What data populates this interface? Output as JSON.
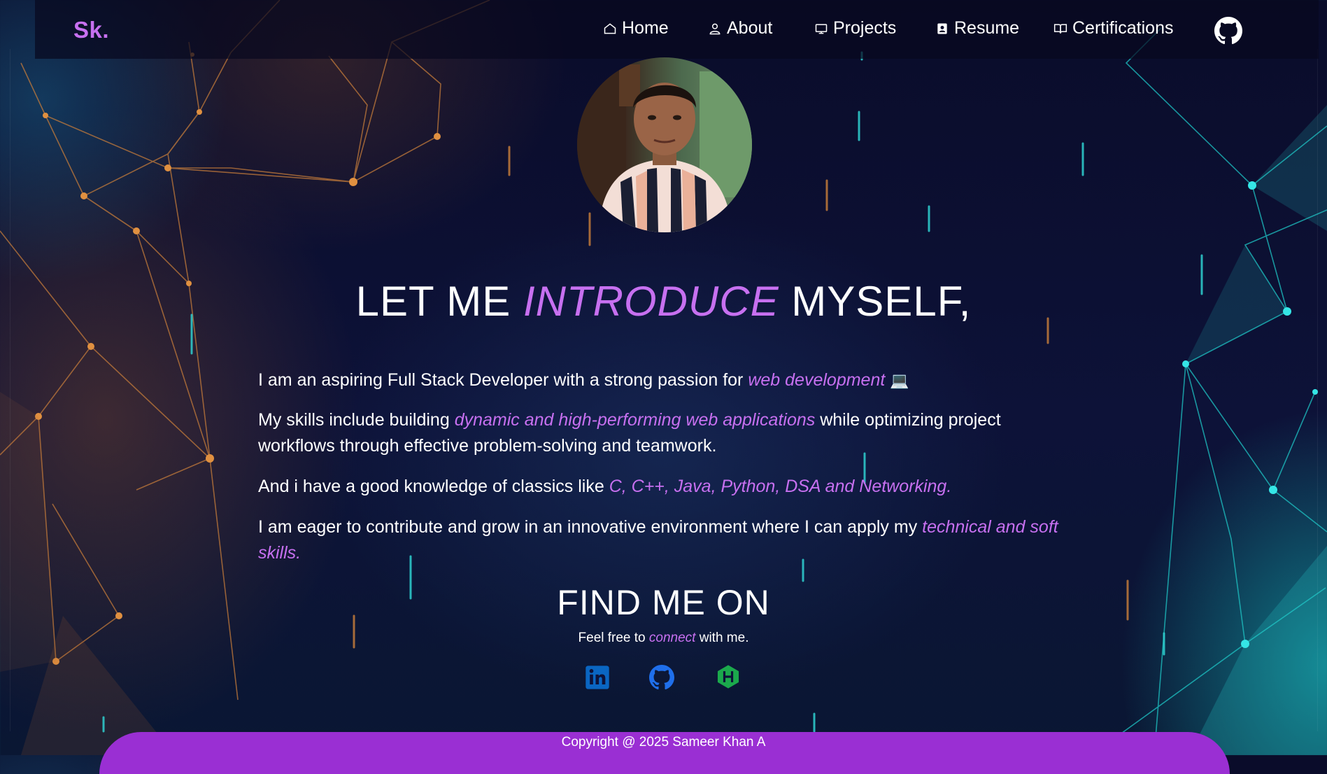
{
  "nav": {
    "logo": "Sk.",
    "items": [
      {
        "label": "Home",
        "icon": "home-icon"
      },
      {
        "label": "About",
        "icon": "user-icon"
      },
      {
        "label": "Projects",
        "icon": "monitor-icon"
      },
      {
        "label": "Resume",
        "icon": "resume-icon"
      },
      {
        "label": "Certifications",
        "icon": "book-icon"
      }
    ],
    "github_icon": "github-icon"
  },
  "intro": {
    "title_pre": "LET ME ",
    "title_accent": "INTRODUCE",
    "title_post": " MYSELF,",
    "p1_text": "I am an aspiring Full Stack Developer with a strong passion for ",
    "p1_highlight": "web development",
    "p1_emoji": "💻",
    "p2_text": "My skills include building ",
    "p2_highlight": "dynamic and high-performing web applications",
    "p2_tail": " while optimizing project workflows through effective problem-solving and teamwork.",
    "p3_text": "And i have a good knowledge of classics like ",
    "p3_highlight": "C, C++, Java, Python, DSA and Networking.",
    "p4_text": "I am eager to contribute and grow in an innovative environment where I can apply my ",
    "p4_highlight": "technical and soft skills."
  },
  "find": {
    "title": "FIND ME ON",
    "sub_pre": "Feel free to ",
    "sub_highlight": "connect",
    "sub_post": " with me.",
    "links": [
      {
        "icon": "linkedin-icon",
        "color": "#0a66c2"
      },
      {
        "icon": "github-icon",
        "color": "#1f6feb"
      },
      {
        "icon": "hackerrank-icon",
        "color": "#1ba94c"
      }
    ]
  },
  "footer": {
    "copyright": "Copyright @ 2025 Sameer Khan A"
  },
  "colors": {
    "accent": "#c770f0",
    "footer_bg": "#9a2fd3",
    "background": "#0d1238"
  }
}
